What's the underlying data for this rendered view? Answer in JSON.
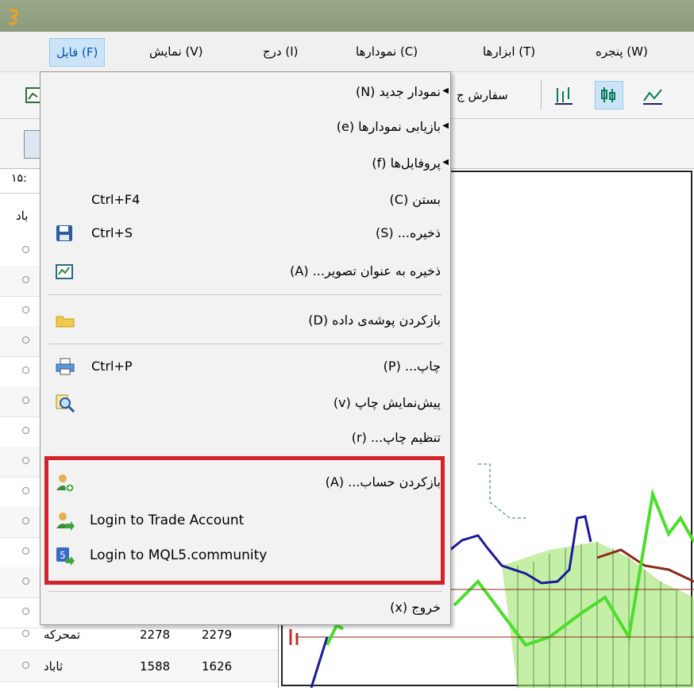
{
  "menubar": {
    "items": [
      "پنجره (W)",
      "ابزارها (T)",
      "نمودارها (C)",
      "درج (I)",
      "نمایش (V)",
      "فایل (F)"
    ],
    "active": "فایل (F)"
  },
  "toolbar": {
    "order_label": "سفارش ج"
  },
  "left_panel": {
    "time": "۱۵:",
    "header_fragment": "باد",
    "rows": [
      {
        "name": "تمحرکه",
        "v1": "2278",
        "v2": "2279"
      },
      {
        "name": "ثاباد",
        "v1": "1588",
        "v2": "1626"
      }
    ]
  },
  "file_menu": {
    "items": [
      {
        "label": "نمودار جدید (N)",
        "submenu": true
      },
      {
        "label": "بازیابی نمودارها (e)",
        "submenu": true
      },
      {
        "label": "پروفایل‌ها (f)",
        "submenu": true
      },
      {
        "label": "بستن (C)",
        "shortcut": "Ctrl+F4"
      },
      {
        "label": "ذخیره... (S)",
        "shortcut": "Ctrl+S",
        "icon": "save-icon"
      },
      {
        "label": "ذخیره به عنوان تصویر... (A)",
        "icon": "save-image-icon"
      },
      {
        "label": "بازکردن پوشه‌ی داده (D)",
        "icon": "folder-icon"
      },
      {
        "label": "چاپ... (P)",
        "shortcut": "Ctrl+P",
        "icon": "printer-icon"
      },
      {
        "label": "پیش‌نمایش چاپ (v)",
        "icon": "print-preview-icon"
      },
      {
        "label": "تنظیم چاپ... (r)"
      },
      {
        "label": "بازکردن حساب... (A)",
        "icon": "open-account-icon"
      },
      {
        "label": "Login to Trade Account",
        "icon": "login-trade-icon"
      },
      {
        "label": "Login to MQL5.community",
        "icon": "login-mql5-icon"
      },
      {
        "label": "خروج (x)"
      }
    ]
  },
  "colors": {
    "highlight": "#d2232a",
    "menu_active_bg": "#cce4f7",
    "titlebar": "#8c9b7c"
  }
}
